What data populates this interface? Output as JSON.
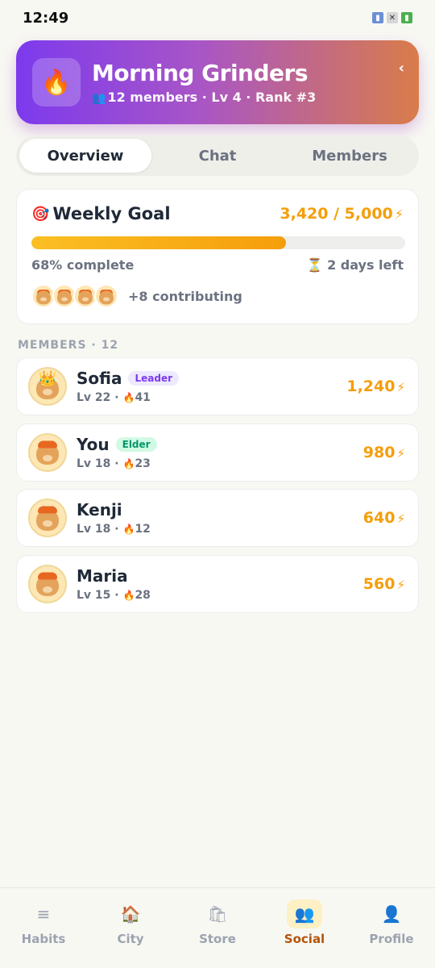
{
  "status_bar": {
    "time": "12:49",
    "icons": [
      "signal-icon",
      "no-sim-icon",
      "battery-icon"
    ]
  },
  "header": {
    "icon": "🔥",
    "title": "Morning Grinders",
    "members_icon": "👥",
    "subtitle": "12 members · Lv 4 · Rank #3",
    "back_icon": "‹",
    "gradient": [
      "#7c3aed",
      "#d97c4a"
    ]
  },
  "tabs": [
    {
      "label": "Overview",
      "active": true
    },
    {
      "label": "Chat",
      "active": false
    },
    {
      "label": "Members",
      "active": false
    }
  ],
  "weekly_goal": {
    "icon": "🎯",
    "title": "Weekly Goal",
    "amount": "3,420 / 5,000",
    "bolt": "⚡",
    "progress": 0.68,
    "complete_text": "68% complete",
    "timer_icon": "⏳",
    "time_left": "2 days left",
    "contributors_shown": 4,
    "contributing_text": "+8 contributing"
  },
  "members_section": {
    "label": "MEMBERS · 12"
  },
  "members": [
    {
      "name": "Sofia",
      "badge": "Leader",
      "badge_type": "leader",
      "level": "Lv 22 · ",
      "flame": "🔥",
      "streak": "41",
      "points": "1,240",
      "crown": true
    },
    {
      "name": "You",
      "badge": "Elder",
      "badge_type": "elder",
      "level": "Lv 18 · ",
      "flame": "🔥",
      "streak": "23",
      "points": "980",
      "crown": false
    },
    {
      "name": "Kenji",
      "badge": "",
      "badge_type": "",
      "level": "Lv 18 · ",
      "flame": "🔥",
      "streak": "12",
      "points": "640",
      "crown": false
    },
    {
      "name": "Maria",
      "badge": "",
      "badge_type": "",
      "level": "Lv 15 · ",
      "flame": "🔥",
      "streak": "28",
      "points": "560",
      "crown": false
    }
  ],
  "bottom_nav": [
    {
      "label": "Habits",
      "icon": "≡",
      "active": false
    },
    {
      "label": "City",
      "icon": "🏠",
      "active": false
    },
    {
      "label": "Store",
      "icon": "🛍",
      "active": false
    },
    {
      "label": "Social",
      "icon": "👥",
      "active": true
    },
    {
      "label": "Profile",
      "icon": "👤",
      "active": false
    }
  ],
  "colors": {
    "accent": "#f59e0b",
    "background": "#f8f8f3",
    "leader_badge": "#7c3aed",
    "elder_badge": "#059669"
  }
}
